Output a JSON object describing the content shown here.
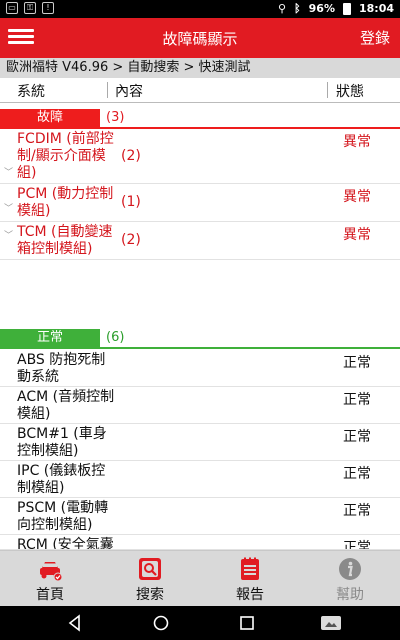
{
  "status_bar": {
    "icons_left": [
      "ocr-icon",
      "vpn-icon",
      "alert-icon"
    ],
    "battery": "96%",
    "time": "18:04"
  },
  "app_bar": {
    "title": "故障碼顯示",
    "login": "登錄"
  },
  "breadcrumb": "歐洲福特 V46.96 > 自動搜索 > 快速測試",
  "columns": {
    "system": "系統",
    "content": "內容",
    "status": "狀態"
  },
  "fault_section": {
    "label": "故障",
    "count": "(3)",
    "rows": [
      {
        "name": "FCDIM (前部控制/顯示介面模組)",
        "code": "(2)",
        "status": "異常"
      },
      {
        "name": "PCM (動力控制模組)",
        "code": "(1)",
        "status": "異常"
      },
      {
        "name": "TCM (自動變速箱控制模組)",
        "code": "(2)",
        "status": "異常"
      }
    ]
  },
  "normal_section": {
    "label": "正常",
    "count": "(6)",
    "rows": [
      {
        "name": "ABS 防抱死制動系統",
        "status": "正常"
      },
      {
        "name": "ACM (音頻控制模組)",
        "status": "正常"
      },
      {
        "name": "BCM#1 (車身控制模組)",
        "status": "正常"
      },
      {
        "name": "IPC (儀錶板控制模組)",
        "status": "正常"
      },
      {
        "name": "PSCM (電動轉向控制模組)",
        "status": "正常"
      },
      {
        "name": "RCM (安全氣囊",
        "status": "正常"
      }
    ]
  },
  "tab_bar": {
    "home": "首頁",
    "search": "搜索",
    "report": "報告",
    "help": "幫助"
  },
  "colors": {
    "accent": "#e11b22",
    "fault": "#d4161d",
    "normal": "#3fb03a",
    "tabbar": "#d9d9d9"
  }
}
